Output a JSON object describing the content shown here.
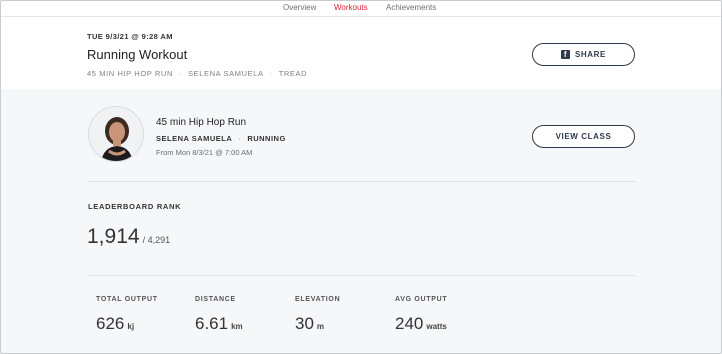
{
  "nav": {
    "tabs": [
      {
        "label": "Overview"
      },
      {
        "label": "Workouts"
      },
      {
        "label": "Achievements"
      }
    ],
    "active_color": "#d5263b"
  },
  "header": {
    "date": "TUE 9/3/21 @ 9:28 AM",
    "title": "Running Workout",
    "meta": [
      "45 MIN HIP HOP RUN",
      "SELENA SAMUELA",
      "TREAD"
    ],
    "share_label": "SHARE",
    "share_icon": "facebook-icon"
  },
  "class_info": {
    "title": "45 min Hip Hop Run",
    "instructor": "SELENA SAMUELA",
    "discipline": "RUNNING",
    "from": "From Mon 8/3/21 @ 7:00 AM",
    "view_class_label": "VIEW CLASS"
  },
  "leaderboard": {
    "label": "LEADERBOARD RANK",
    "rank": "1,914",
    "total": "/ 4,291"
  },
  "stats": [
    {
      "label": "TOTAL OUTPUT",
      "value": "626",
      "unit": "kj"
    },
    {
      "label": "DISTANCE",
      "value": "6.61",
      "unit": "km"
    },
    {
      "label": "ELEVATION",
      "value": "30",
      "unit": "m"
    },
    {
      "label": "AVG OUTPUT",
      "value": "240",
      "unit": "watts"
    }
  ]
}
